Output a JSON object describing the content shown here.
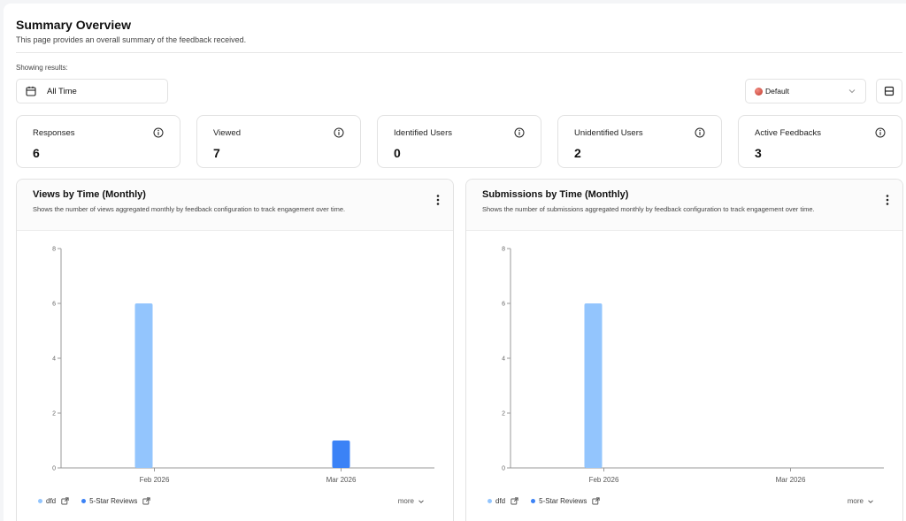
{
  "header": {
    "title": "Summary Overview",
    "subtitle": "This page provides an overall summary of the feedback received."
  },
  "filters": {
    "showing_label": "Showing results:",
    "date_range": "All Time",
    "view_select": "Default"
  },
  "stats": [
    {
      "label": "Responses",
      "value": "6"
    },
    {
      "label": "Viewed",
      "value": "7"
    },
    {
      "label": "Identified Users",
      "value": "0"
    },
    {
      "label": "Unidentified Users",
      "value": "2"
    },
    {
      "label": "Active Feedbacks",
      "value": "3"
    }
  ],
  "charts": [
    {
      "title": "Views by Time (Monthly)",
      "description": "Shows the number of views aggregated monthly by feedback configuration to track engagement over time.",
      "legend": [
        {
          "name": "dfd",
          "color": "#93c5fd"
        },
        {
          "name": "5-Star Reviews",
          "color": "#3b82f6"
        }
      ],
      "more_label": "more"
    },
    {
      "title": "Submissions by Time (Monthly)",
      "description": "Shows the number of submissions aggregated monthly by feedback configuration to track engagement over time.",
      "legend": [
        {
          "name": "dfd",
          "color": "#93c5fd"
        },
        {
          "name": "5-Star Reviews",
          "color": "#3b82f6"
        }
      ],
      "more_label": "more"
    }
  ],
  "chart_data": [
    {
      "type": "bar",
      "title": "Views by Time (Monthly)",
      "categories": [
        "Feb 2026",
        "Mar 2026"
      ],
      "series": [
        {
          "name": "dfd",
          "color": "#93c5fd",
          "values": [
            6,
            0
          ]
        },
        {
          "name": "5-Star Reviews",
          "color": "#3b82f6",
          "values": [
            0,
            1
          ]
        }
      ],
      "ylim": [
        0,
        8
      ],
      "yticks": [
        0,
        2,
        4,
        6,
        8
      ],
      "grid": false
    },
    {
      "type": "bar",
      "title": "Submissions by Time (Monthly)",
      "categories": [
        "Feb 2026",
        "Mar 2026"
      ],
      "series": [
        {
          "name": "dfd",
          "color": "#93c5fd",
          "values": [
            6,
            0
          ]
        },
        {
          "name": "5-Star Reviews",
          "color": "#3b82f6",
          "values": [
            0,
            0
          ]
        }
      ],
      "ylim": [
        0,
        8
      ],
      "yticks": [
        0,
        2,
        4,
        6,
        8
      ],
      "grid": false
    }
  ]
}
